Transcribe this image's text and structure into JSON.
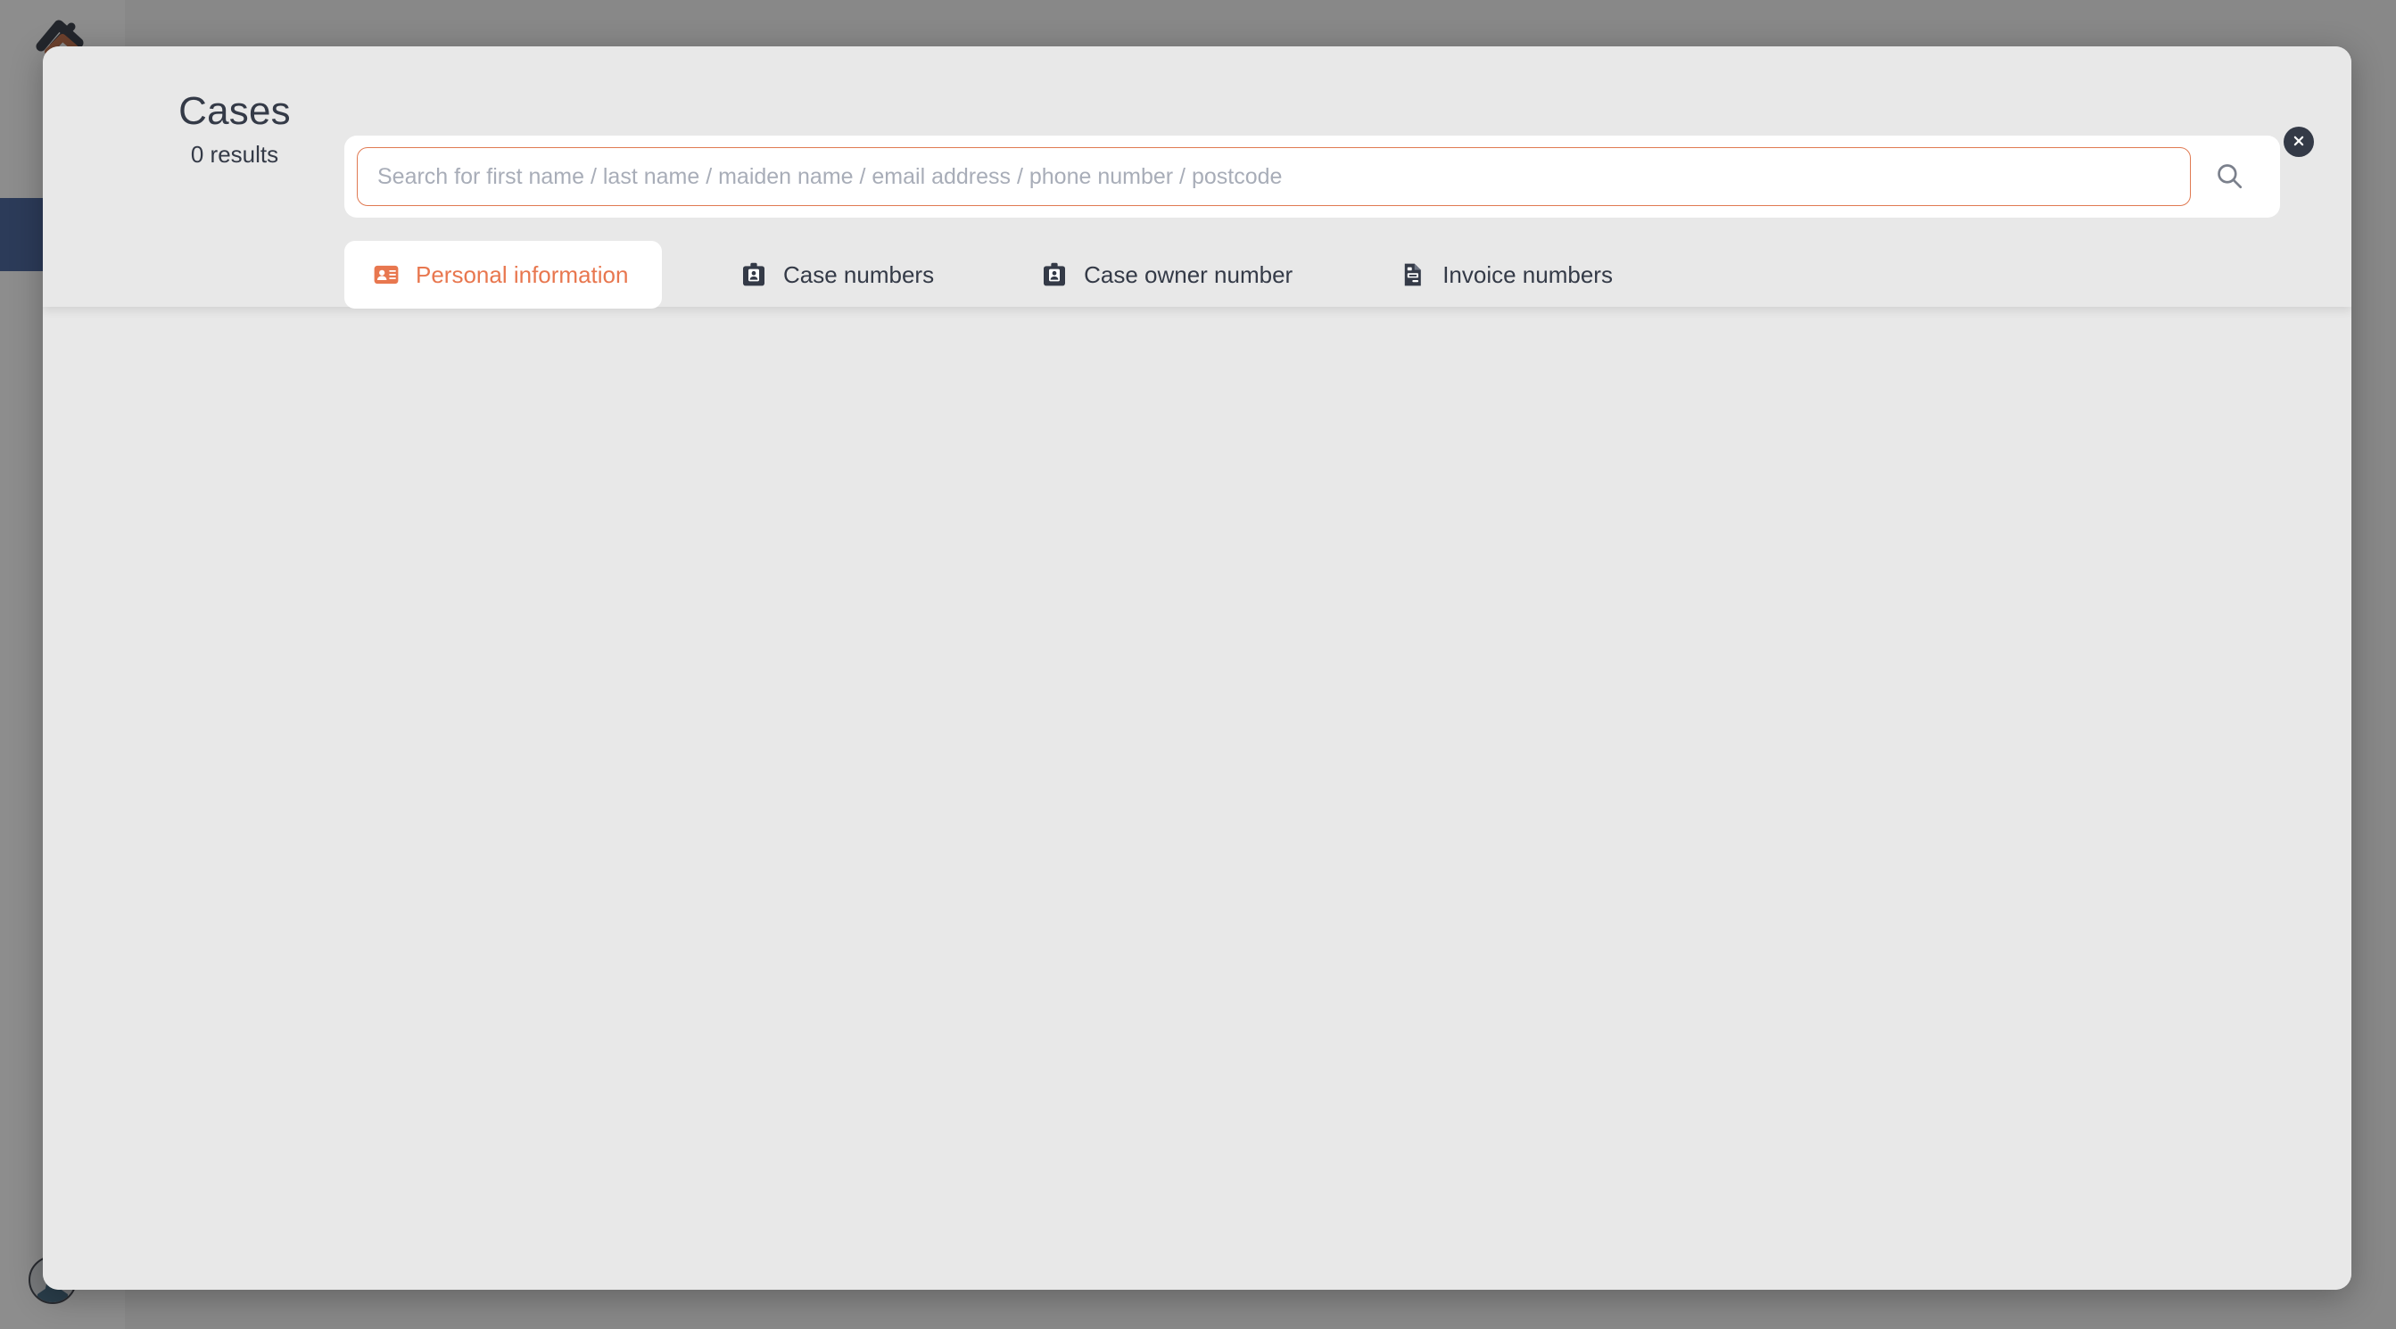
{
  "colors": {
    "accent_orange": "#e8774f",
    "input_border_orange": "#e07a52",
    "dark_slate": "#343a47",
    "sidebar_active_blue": "#31518f",
    "modal_background": "#e8e8e8",
    "card_white": "#ffffff",
    "scrim": "#7d7d7d",
    "placeholder_grey": "#a8adb8"
  },
  "modal": {
    "title": "Cases",
    "results_count": "0 results",
    "close_icon": "close-icon",
    "close_label": "Close"
  },
  "search": {
    "value": "",
    "placeholder": "Search for first name / last name / maiden name / email address / phone number / postcode",
    "submit_icon": "search-icon",
    "submit_label": "Search"
  },
  "tabs": [
    {
      "label": "Personal information",
      "icon": "id-card-icon",
      "active": true
    },
    {
      "label": "Case numbers",
      "icon": "id-badge-icon",
      "active": false
    },
    {
      "label": "Case owner number",
      "icon": "id-badge-icon",
      "active": false
    },
    {
      "label": "Invoice numbers",
      "icon": "invoice-document-icon",
      "active": false
    }
  ],
  "sidebar": {
    "logo_icon": "app-logo-icon",
    "active_item_label": "",
    "avatar_icon": "user-avatar-icon"
  }
}
